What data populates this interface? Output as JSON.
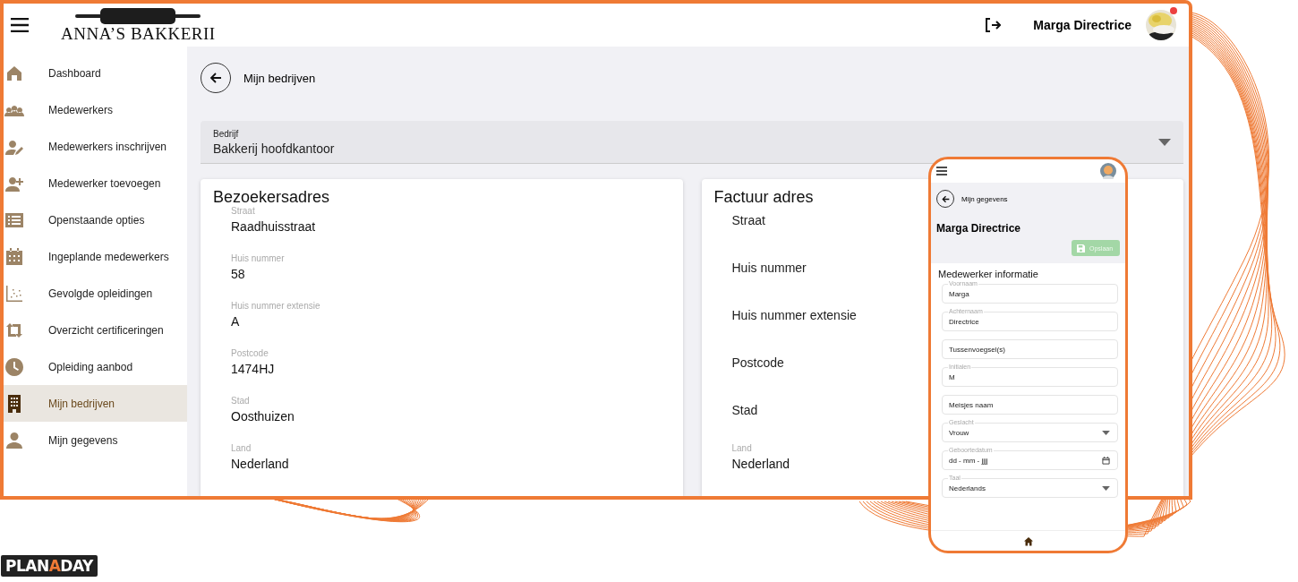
{
  "header": {
    "logo_text": "ANNA’S BAKKERII",
    "user_name": "Marga Directrice",
    "notification": true
  },
  "sidebar": {
    "items": [
      {
        "label": "Dashboard",
        "selected": false
      },
      {
        "label": "Medewerkers",
        "selected": false
      },
      {
        "label": "Medewerkers inschrijven",
        "selected": false
      },
      {
        "label": "Medewerker toevoegen",
        "selected": false
      },
      {
        "label": "Openstaande opties",
        "selected": false
      },
      {
        "label": "Ingeplande medewerkers",
        "selected": false
      },
      {
        "label": "Gevolgde opleidingen",
        "selected": false
      },
      {
        "label": "Overzicht certificeringen",
        "selected": false
      },
      {
        "label": "Opleiding aanbod",
        "selected": false
      },
      {
        "label": "Mijn bedrijven",
        "selected": true
      },
      {
        "label": "Mijn gegevens",
        "selected": false
      }
    ]
  },
  "page": {
    "title": "Mijn bedrijven",
    "company_select": {
      "label": "Bedrijf",
      "value": "Bakkerij hoofdkantoor"
    },
    "cards": [
      {
        "title": "Bezoekersadres",
        "fields": [
          {
            "label": "Straat",
            "value": "Raadhuisstraat"
          },
          {
            "label": "Huis nummer",
            "value": "58"
          },
          {
            "label": "Huis nummer extensie",
            "value": "A"
          },
          {
            "label": "Postcode",
            "value": "1474HJ"
          },
          {
            "label": "Stad",
            "value": "Oosthuizen"
          },
          {
            "label": "Land",
            "value": "Nederland"
          }
        ]
      },
      {
        "title": "Factuur adres",
        "fields": [
          {
            "label": "Straat"
          },
          {
            "label": "Huis nummer"
          },
          {
            "label": "Huis nummer extensie"
          },
          {
            "label": "Postcode"
          },
          {
            "label": "Stad"
          },
          {
            "label": "Land",
            "value": "Nederland"
          }
        ]
      }
    ]
  },
  "phone": {
    "back_title": "Mijn gegevens",
    "name": "Marga Directrice",
    "save_button": {
      "label": "Opslaan",
      "disabled": true
    },
    "section_title": "Medewerker informatie",
    "fields": [
      {
        "kind": "text",
        "label": "Voornaam",
        "value": "Marga"
      },
      {
        "kind": "text",
        "label": "Achternaam",
        "value": "Directrice"
      },
      {
        "kind": "text",
        "placeholder": "Tussenvoegsel(s)"
      },
      {
        "kind": "text",
        "label": "Initialen",
        "value": "M"
      },
      {
        "kind": "text",
        "placeholder": "Meisjes naam"
      },
      {
        "kind": "select",
        "label": "Geslacht",
        "value": "Vrouw"
      },
      {
        "kind": "date",
        "label": "Geboortedatum",
        "value": "dd - mm - jjjj"
      },
      {
        "kind": "select",
        "label": "Taal",
        "value": "Nederlands"
      }
    ]
  },
  "brand": [
    {
      "text": "PLAN",
      "accent": false
    },
    {
      "text": "A",
      "accent": true
    },
    {
      "text": "DAY",
      "accent": false
    }
  ]
}
